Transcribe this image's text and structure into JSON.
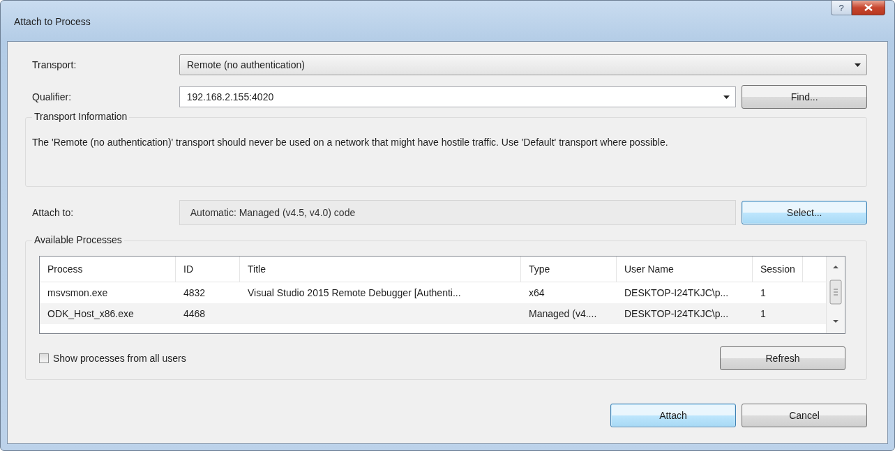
{
  "window": {
    "title": "Attach to Process",
    "help": "?"
  },
  "transport": {
    "label": "Transport:",
    "value": "Remote (no authentication)"
  },
  "qualifier": {
    "label": "Qualifier:",
    "value": "192.168.2.155:4020",
    "button": {
      "label": "Find...",
      "highlighted": false
    }
  },
  "transport_information": {
    "title": "Transport Information",
    "text": "The 'Remote (no authentication)' transport should never be used on a network that might have hostile traffic. Use 'Default' transport where possible."
  },
  "attach_to": {
    "label": "Attach to:",
    "value": "Automatic: Managed (v4.5, v4.0) code",
    "button": {
      "label": "Select...",
      "highlighted": true
    }
  },
  "available_processes": {
    "title": "Available Processes",
    "table": {
      "columns": [
        "Process",
        "ID",
        "Title",
        "Type",
        "User Name",
        "Session"
      ],
      "rows": [
        [
          "msvsmon.exe",
          "4832",
          "Visual Studio 2015 Remote Debugger [Authenti...",
          "x64",
          "DESKTOP-I24TKJC\\p...",
          "1"
        ],
        [
          "ODK_Host_x86.exe",
          "4468",
          "",
          "Managed (v4....",
          "DESKTOP-I24TKJC\\p...",
          "1"
        ]
      ]
    },
    "show_all_users": {
      "label": "Show processes from all users",
      "checked": false
    },
    "refresh": {
      "label": "Refresh",
      "highlighted": false
    }
  },
  "buttons": [
    {
      "label": "Attach",
      "highlighted": true
    },
    {
      "label": "Cancel",
      "highlighted": false
    }
  ]
}
